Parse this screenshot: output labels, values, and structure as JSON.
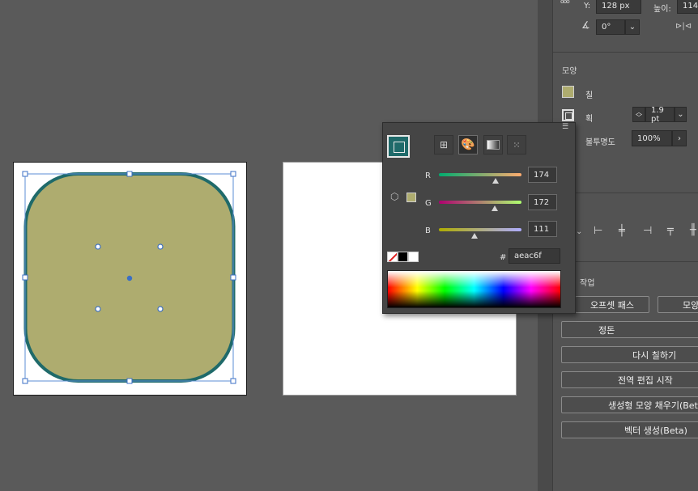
{
  "transform": {
    "y_label": "Y:",
    "y_value": "128 px",
    "h_label": "높이:",
    "h_value": "114",
    "angle_value": "0°"
  },
  "appearance": {
    "section_title": "모양",
    "fill_label": "칠",
    "stroke_label": "획",
    "stroke_weight": "1.9 pt",
    "opacity_label": "불투명도",
    "opacity_value": "100%",
    "fill_color": "#aeac6f",
    "stroke_color": "#1f6a6a"
  },
  "quick_actions": {
    "section_title": "작업",
    "offset_path": "오프셋 패스",
    "shape_partial": "모양",
    "arrange": "정돈",
    "recolor": "다시 칠하기",
    "global_edit": "전역 편집 시작",
    "gen_shape_fill": "생성형 모양 채우기(Beta)",
    "gen_vector": "벡터 생성(Beta)"
  },
  "color_picker": {
    "channels": [
      {
        "label": "R",
        "value": "174",
        "level": 0.682
      },
      {
        "label": "G",
        "value": "172",
        "level": 0.675
      },
      {
        "label": "B",
        "value": "111",
        "level": 0.435
      }
    ],
    "hash_label": "#",
    "hex_value": "aeac6f",
    "current_color": "#aeac6f"
  }
}
